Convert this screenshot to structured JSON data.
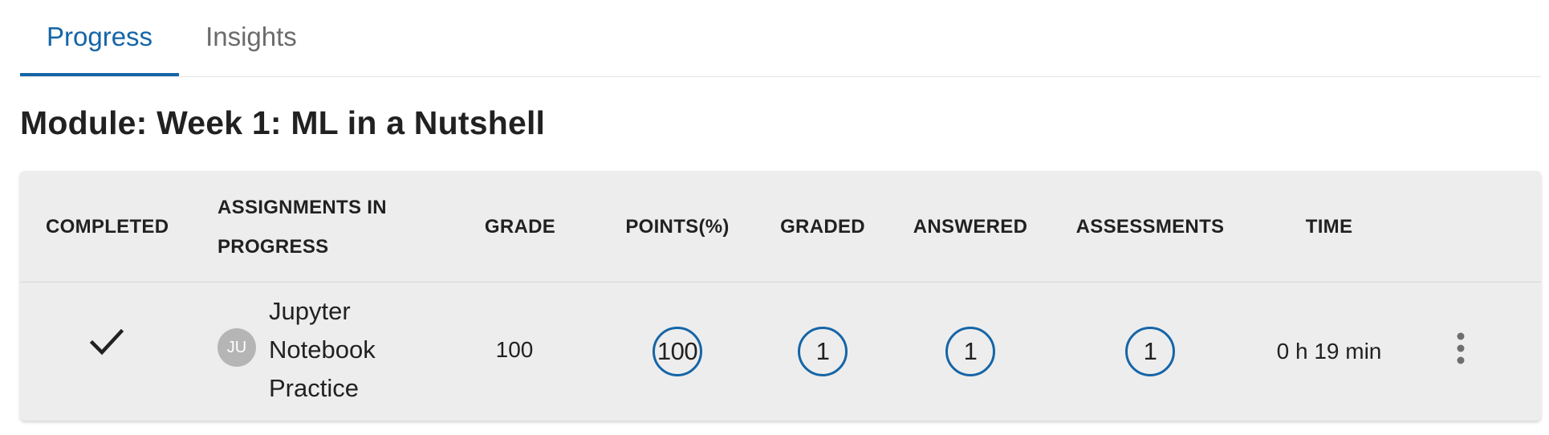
{
  "tabs": [
    {
      "label": "Progress",
      "active": true
    },
    {
      "label": "Insights",
      "active": false
    }
  ],
  "module": {
    "title": "Module: Week 1: ML in a Nutshell"
  },
  "table": {
    "headers": {
      "completed": "COMPLETED",
      "assignments": "ASSIGNMENTS IN PROGRESS",
      "grade": "GRADE",
      "points": "POINTS(%)",
      "graded": "GRADED",
      "answered": "ANSWERED",
      "assessments": "ASSESSMENTS",
      "time": "TIME"
    },
    "rows": [
      {
        "completed_icon": "check-icon",
        "avatar_initials": "JU",
        "assignment": "Jupyter Notebook Practice",
        "grade": "100",
        "points": "100",
        "graded": "1",
        "answered": "1",
        "assessments": "1",
        "time": "0 h 19 min",
        "menu_icon": "more-vertical-icon"
      }
    ]
  },
  "colors": {
    "accent": "#1565a7",
    "card_bg": "#ededed",
    "avatar_bg": "#b5b5b5"
  }
}
